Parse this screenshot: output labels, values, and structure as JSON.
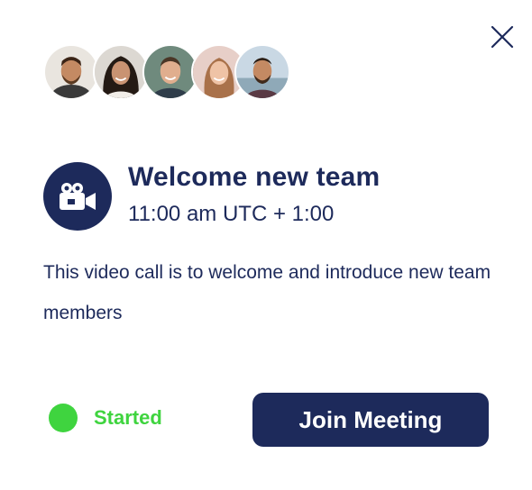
{
  "close": {
    "icon": "close-icon"
  },
  "participants": [
    {
      "name": "participant-1",
      "icon": "avatar"
    },
    {
      "name": "participant-2",
      "icon": "avatar"
    },
    {
      "name": "participant-3",
      "icon": "avatar"
    },
    {
      "name": "participant-4",
      "icon": "avatar"
    },
    {
      "name": "participant-5",
      "icon": "avatar"
    }
  ],
  "event": {
    "icon": "video-camera-icon",
    "title": "Welcome new team",
    "time": "11:00 am UTC + 1:00",
    "description": "This video call is to welcome and introduce new team members"
  },
  "status": {
    "label": "Started",
    "color": "#3fd43f"
  },
  "join_button": {
    "label": "Join Meeting"
  },
  "colors": {
    "primary": "#1d2a5b",
    "status_green": "#3fd43f",
    "background": "#ffffff"
  }
}
